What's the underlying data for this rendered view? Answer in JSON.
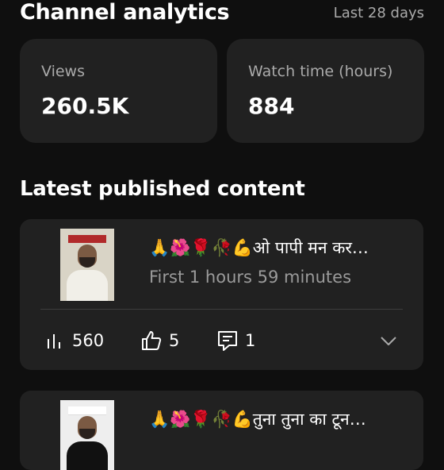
{
  "header": {
    "title": "Channel analytics",
    "period": "Last 28 days"
  },
  "stats": [
    {
      "label": "Views",
      "value": "260.5K"
    },
    {
      "label": "Watch time (hours)",
      "value": "884"
    }
  ],
  "section_title": "Latest published content",
  "content": [
    {
      "title": "🙏🌺🌹🥀💪ओ पापी मन कर…",
      "subtitle": "First 1 hours 59 minutes",
      "views": "560",
      "likes": "5",
      "comments": "1",
      "icons": {
        "views": "bar-chart-icon",
        "likes": "thumbs-up-icon",
        "comments": "comment-icon",
        "expand": "chevron-down-icon"
      }
    },
    {
      "title": "🙏🌺🌹🥀💪तुना तुना का टून…"
    }
  ],
  "colors": {
    "background": "#0f0f0f",
    "card": "#212121",
    "muted_text": "#aaaaaa"
  }
}
